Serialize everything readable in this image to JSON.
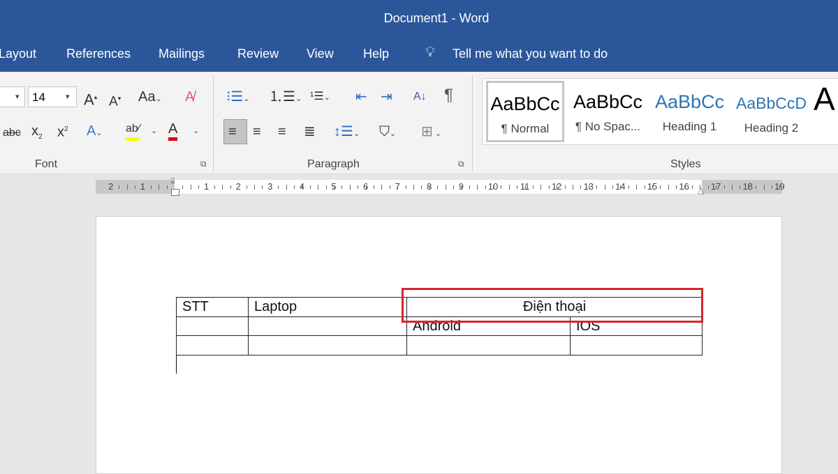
{
  "window": {
    "title": "Document1  -  Word",
    "accent": "#2b579a"
  },
  "tabs": [
    "Layout",
    "References",
    "Mailings",
    "Review",
    "View",
    "Help"
  ],
  "tell_me": "Tell me what you want to do",
  "font": {
    "size": "14",
    "group_label": "Font",
    "highlight_color": "#ffff00",
    "font_color": "#e00000"
  },
  "paragraph": {
    "group_label": "Paragraph"
  },
  "styles": {
    "group_label": "Styles",
    "preview": "AaBbCc",
    "items": [
      {
        "preview": "AaBbCc",
        "name": "¶ Normal",
        "selected": true
      },
      {
        "preview": "AaBbCc",
        "name": "¶ No Spac...",
        "selected": false
      },
      {
        "preview": "AaBbCc",
        "name": "Heading 1",
        "selected": false
      },
      {
        "preview": "AaBbCcD",
        "name": "Heading 2",
        "selected": false
      }
    ],
    "more_preview": "A"
  },
  "ruler": {
    "left_labels": [
      "2",
      "1"
    ],
    "main_labels": [
      "1",
      "2",
      "3",
      "4",
      "5",
      "6",
      "7",
      "8",
      "9",
      "10",
      "11",
      "12",
      "13",
      "14",
      "15",
      "16"
    ],
    "right_labels": [
      "17",
      "18",
      "19"
    ]
  },
  "table": {
    "rows": [
      [
        "STT",
        "Laptop",
        "Điện thoại"
      ],
      [
        "",
        "",
        "Android",
        "IOS"
      ],
      [
        "",
        "",
        "",
        ""
      ]
    ],
    "highlight_color": "#d9232d"
  }
}
